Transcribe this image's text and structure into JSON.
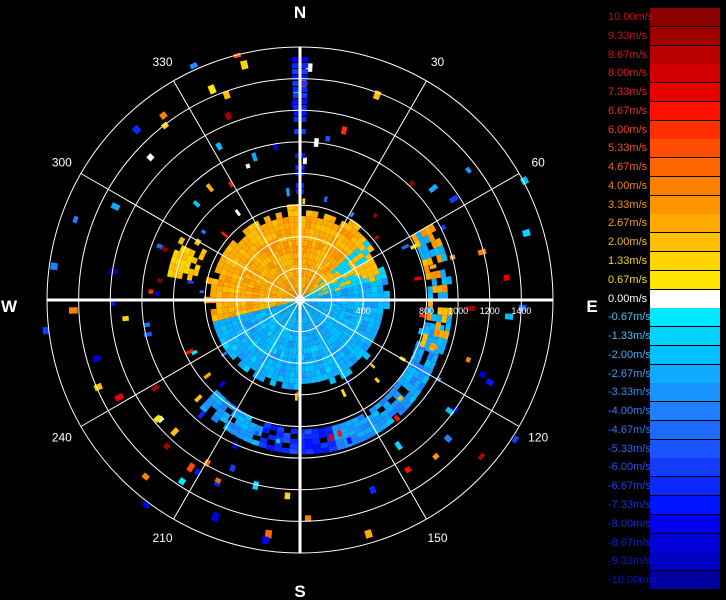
{
  "chart_data": {
    "type": "polar-radar-velocity",
    "compass": {
      "north": "N",
      "south": "S",
      "east": "E",
      "west": "W"
    },
    "bearing_labels": [
      {
        "bearing": 30,
        "label": "30"
      },
      {
        "bearing": 60,
        "label": "60"
      },
      {
        "bearing": 120,
        "label": "120"
      },
      {
        "bearing": 150,
        "label": "150"
      },
      {
        "bearing": 210,
        "label": "210"
      },
      {
        "bearing": 240,
        "label": "240"
      },
      {
        "bearing": 300,
        "label": "300"
      },
      {
        "bearing": 330,
        "label": "330"
      }
    ],
    "range_max": 1600,
    "range_rings": [
      200,
      400,
      600,
      800,
      1000,
      1200,
      1400,
      1600
    ],
    "range_labels": [
      {
        "range": 400,
        "label": "400"
      },
      {
        "range": 800,
        "label": "800"
      },
      {
        "range": 1000,
        "label": "1000"
      },
      {
        "range": 1200,
        "label": "1200"
      },
      {
        "range": 1400,
        "label": "1400"
      }
    ],
    "legend": [
      {
        "label": "10.00m/s",
        "value": 10.0,
        "color": "#8b0000",
        "text_color": "#c01010"
      },
      {
        "label": "9.33m/s",
        "value": 9.33,
        "color": "#a00000",
        "text_color": "#c81414"
      },
      {
        "label": "8.67m/s",
        "value": 8.67,
        "color": "#b80000",
        "text_color": "#d01818"
      },
      {
        "label": "8.00m/s",
        "value": 8.0,
        "color": "#d00000",
        "text_color": "#d81c1c"
      },
      {
        "label": "7.33m/s",
        "value": 7.33,
        "color": "#e80000",
        "text_color": "#e02020"
      },
      {
        "label": "6.67m/s",
        "value": 6.67,
        "color": "#ff1000",
        "text_color": "#e83020"
      },
      {
        "label": "6.00m/s",
        "value": 6.0,
        "color": "#ff3000",
        "text_color": "#f04020"
      },
      {
        "label": "5.33m/s",
        "value": 5.33,
        "color": "#ff4c00",
        "text_color": "#f05020"
      },
      {
        "label": "4.67m/s",
        "value": 4.67,
        "color": "#ff6600",
        "text_color": "#f06020"
      },
      {
        "label": "4.00m/s",
        "value": 4.0,
        "color": "#ff8000",
        "text_color": "#f08020"
      },
      {
        "label": "3.33m/s",
        "value": 3.33,
        "color": "#ff9400",
        "text_color": "#f09020"
      },
      {
        "label": "2.67m/s",
        "value": 2.67,
        "color": "#ffaa00",
        "text_color": "#f0a020"
      },
      {
        "label": "2.00m/s",
        "value": 2.0,
        "color": "#ffbe00",
        "text_color": "#f0b820"
      },
      {
        "label": "1.33m/s",
        "value": 1.33,
        "color": "#ffd400",
        "text_color": "#f0d020"
      },
      {
        "label": "0.67m/s",
        "value": 0.67,
        "color": "#ffe600",
        "text_color": "#f0e020"
      },
      {
        "label": "0.00m/s",
        "value": 0.0,
        "color": "#ffffff",
        "text_color": "#ffffff"
      },
      {
        "label": "-0.67m/s",
        "value": -0.67,
        "color": "#00e8ff",
        "text_color": "#40c8f0"
      },
      {
        "label": "-1.33m/s",
        "value": -1.33,
        "color": "#00d4ff",
        "text_color": "#40c0f0"
      },
      {
        "label": "-2.00m/s",
        "value": -2.0,
        "color": "#00c0ff",
        "text_color": "#40b0f0"
      },
      {
        "label": "-2.67m/s",
        "value": -2.67,
        "color": "#10aaff",
        "text_color": "#40a0f0"
      },
      {
        "label": "-3.33m/s",
        "value": -3.33,
        "color": "#1a94ff",
        "text_color": "#3090f0"
      },
      {
        "label": "-4.00m/s",
        "value": -4.0,
        "color": "#1e80ff",
        "text_color": "#3080f0"
      },
      {
        "label": "-4.67m/s",
        "value": -4.67,
        "color": "#1e6aff",
        "text_color": "#3070f0"
      },
      {
        "label": "-5.33m/s",
        "value": -5.33,
        "color": "#1a54ff",
        "text_color": "#3060f0"
      },
      {
        "label": "-6.00m/s",
        "value": -6.0,
        "color": "#143cff",
        "text_color": "#2850f0"
      },
      {
        "label": "-6.67m/s",
        "value": -6.67,
        "color": "#0a28ff",
        "text_color": "#2040e8"
      },
      {
        "label": "-7.33m/s",
        "value": -7.33,
        "color": "#0014ff",
        "text_color": "#1830e0"
      },
      {
        "label": "-8.00m/s",
        "value": -8.0,
        "color": "#0000f0",
        "text_color": "#1028d8"
      },
      {
        "label": "-8.67m/s",
        "value": -8.67,
        "color": "#0000d8",
        "text_color": "#1020d0"
      },
      {
        "label": "-9.33m/s",
        "value": -9.33,
        "color": "#0000c0",
        "text_color": "#1018c8"
      },
      {
        "label": "-10.00m/s",
        "value": -10.0,
        "color": "#0000a0",
        "text_color": "#1010c0"
      }
    ]
  }
}
